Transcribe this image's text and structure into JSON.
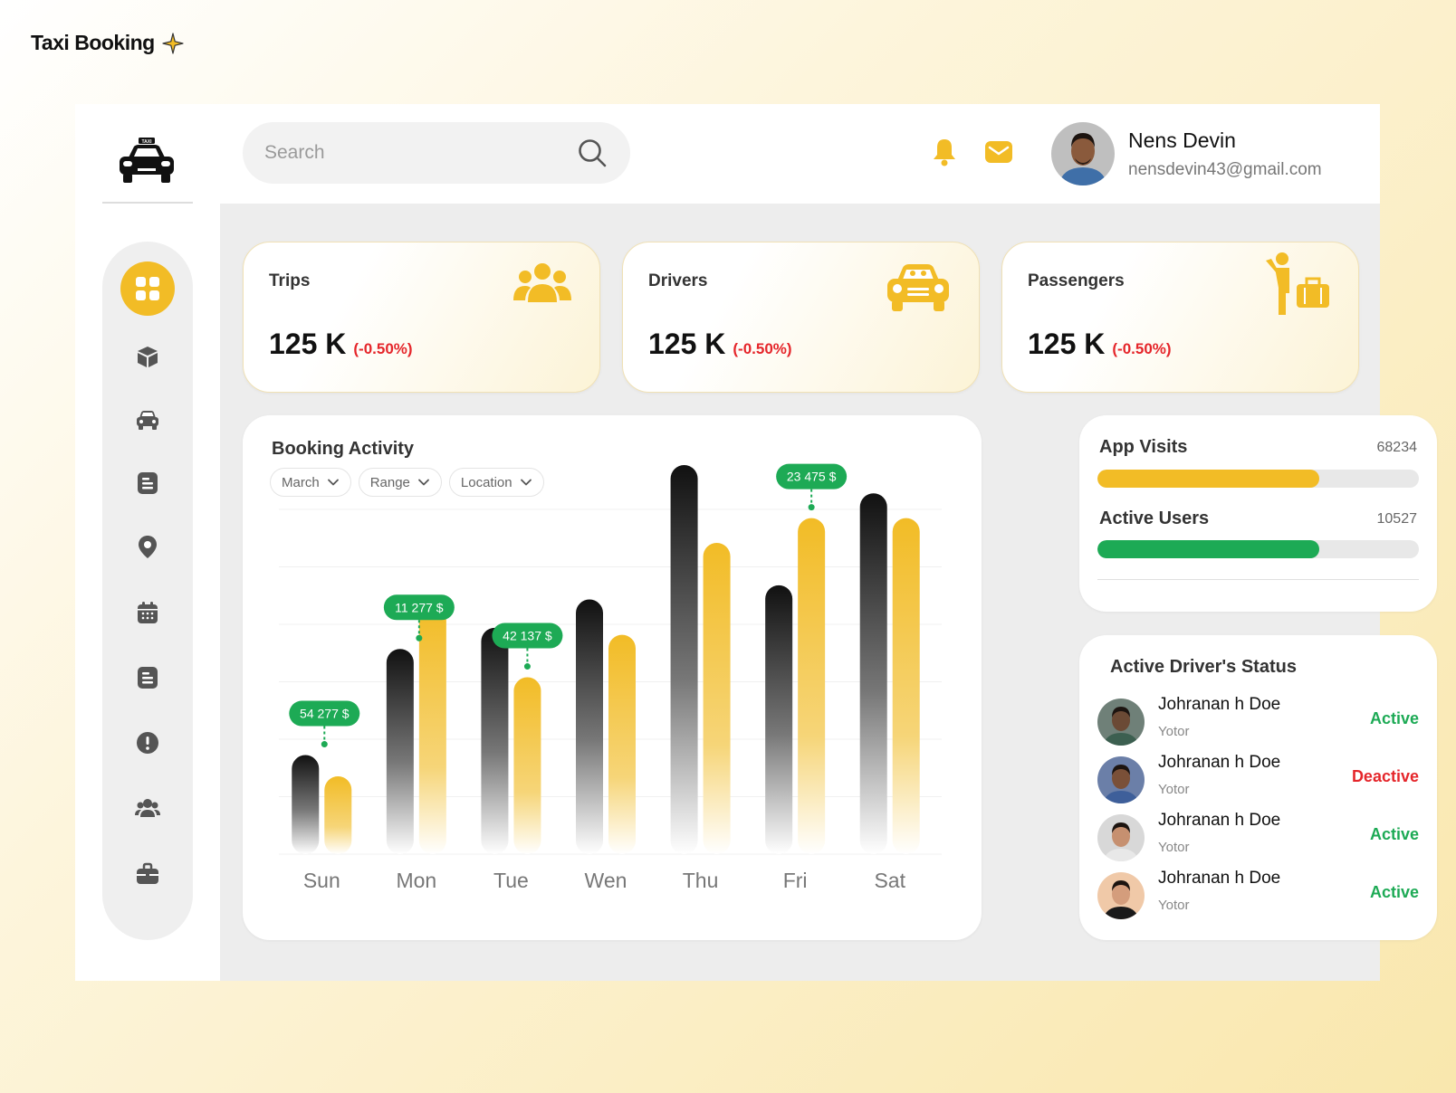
{
  "brand": {
    "title": "Taxi Booking"
  },
  "search": {
    "placeholder": "Search"
  },
  "user": {
    "name": "Nens Devin",
    "email": "nensdevin43@gmail.com"
  },
  "sidebar": {
    "items": [
      {
        "icon": "dashboard-grid-icon",
        "active": true
      },
      {
        "icon": "box-icon"
      },
      {
        "icon": "car-icon"
      },
      {
        "icon": "document-icon"
      },
      {
        "icon": "location-pin-icon"
      },
      {
        "icon": "calendar-icon"
      },
      {
        "icon": "list-document-icon"
      },
      {
        "icon": "alert-icon"
      },
      {
        "icon": "users-icon"
      },
      {
        "icon": "briefcase-icon"
      }
    ]
  },
  "stats": [
    {
      "title": "Trips",
      "value": "125 K",
      "change": "(-0.50%)",
      "icon": "group-icon"
    },
    {
      "title": "Drivers",
      "value": "125 K",
      "change": "(-0.50%)",
      "icon": "taxi-front-icon"
    },
    {
      "title": "Passengers",
      "value": "125 K",
      "change": "(-0.50%)",
      "icon": "passenger-luggage-icon"
    }
  ],
  "booking": {
    "title": "Booking Activity",
    "filters": [
      "March",
      "Range",
      "Location"
    ]
  },
  "chart_data": {
    "type": "bar",
    "categories": [
      "Sun",
      "Mon",
      "Tue",
      "Wen",
      "Thu",
      "Fri",
      "Sat"
    ],
    "series": [
      {
        "values": [
          28,
          58,
          64,
          72,
          110,
          76,
          102
        ]
      },
      {
        "values": [
          22,
          70,
          50,
          62,
          88,
          95,
          95
        ]
      }
    ],
    "annotations": [
      {
        "category": "Sun",
        "label": "54 277 $"
      },
      {
        "category": "Mon",
        "label": "11 277 $"
      },
      {
        "category": "Tue",
        "label": "42 137 $"
      },
      {
        "category": "Fri",
        "label": "23 475 $"
      }
    ],
    "ylim": [
      0,
      110
    ],
    "grid": true,
    "colors": {
      "dark": "#111111",
      "yellow": "#f2bc26",
      "badge": "#1daa55"
    }
  },
  "visits": {
    "app_visits_label": "App Visits",
    "app_visits_value": "68234",
    "app_visits_fill": 0.69,
    "active_users_label": "Active Users",
    "active_users_value": "10527",
    "active_users_fill": 0.69
  },
  "drivers": {
    "title": "Active Driver's Status",
    "rows": [
      {
        "name": "Johranan h Doe",
        "sub": "Yotor",
        "status": "Active"
      },
      {
        "name": "Johranan h Doe",
        "sub": "Yotor",
        "status": "Deactive"
      },
      {
        "name": "Johranan h Doe",
        "sub": "Yotor",
        "status": "Active"
      },
      {
        "name": "Johranan h Doe",
        "sub": "Yotor",
        "status": "Active"
      }
    ]
  },
  "colors": {
    "accent": "#f2bc26",
    "green": "#1daa55",
    "red": "#e5262b"
  }
}
